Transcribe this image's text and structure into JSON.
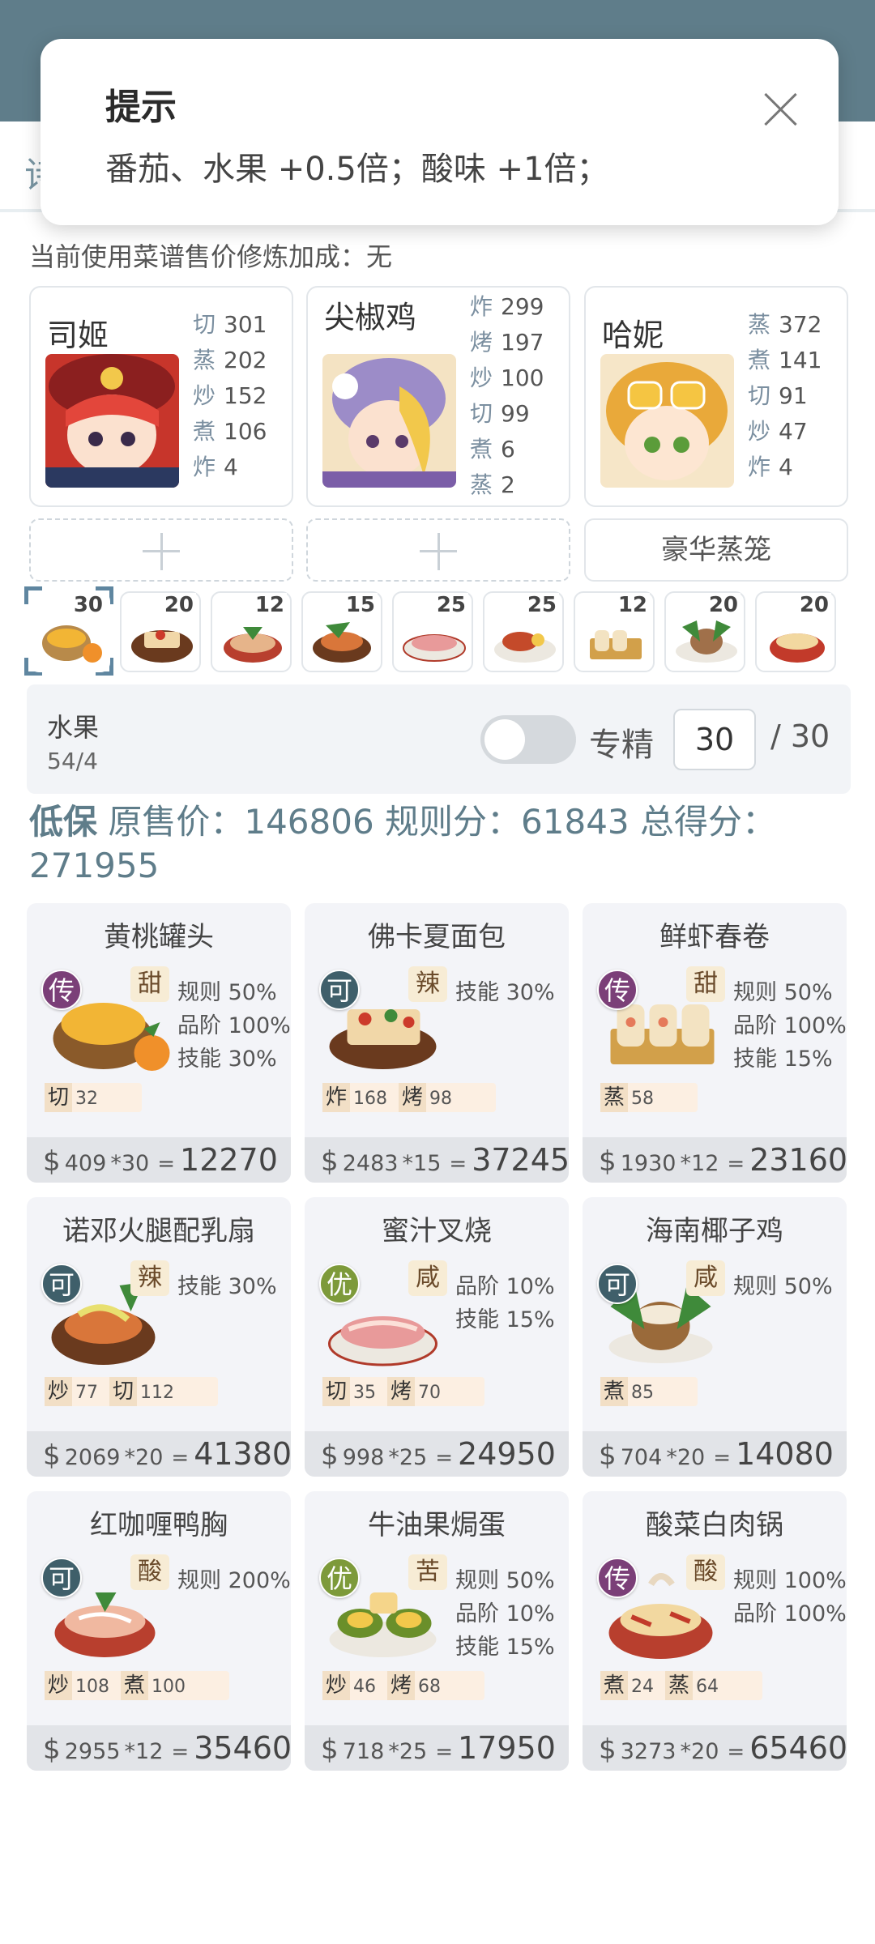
{
  "dialog": {
    "title": "提示",
    "message": "番茄、水果 +0.5倍；酸味 +1倍；",
    "tab_stub": "诗"
  },
  "bonus_line": "当前使用菜谱售价修炼加成：无",
  "chefs": [
    {
      "name": "司姬",
      "skills": [
        {
          "k": "切",
          "v": "301"
        },
        {
          "k": "蒸",
          "v": "202"
        },
        {
          "k": "炒",
          "v": "152"
        },
        {
          "k": "煮",
          "v": "106"
        },
        {
          "k": "炸",
          "v": "4"
        }
      ]
    },
    {
      "name": "尖椒鸡",
      "skills": [
        {
          "k": "炸",
          "v": "299"
        },
        {
          "k": "烤",
          "v": "197"
        },
        {
          "k": "炒",
          "v": "100"
        },
        {
          "k": "切",
          "v": "99"
        },
        {
          "k": "煮",
          "v": "6"
        },
        {
          "k": "蒸",
          "v": "2"
        }
      ]
    },
    {
      "name": "哈妮",
      "skills": [
        {
          "k": "蒸",
          "v": "372"
        },
        {
          "k": "煮",
          "v": "141"
        },
        {
          "k": "切",
          "v": "91"
        },
        {
          "k": "炒",
          "v": "47"
        },
        {
          "k": "炸",
          "v": "4"
        }
      ]
    }
  ],
  "equipment": {
    "label": "豪华蒸笼"
  },
  "dish_bar": [
    "30",
    "20",
    "12",
    "15",
    "25",
    "25",
    "12",
    "20",
    "20"
  ],
  "selected": {
    "name": "水果",
    "fraction": "54/4",
    "toggle_label": "专精",
    "qty": "30",
    "max": "/ 30"
  },
  "summary": {
    "lead": "低保",
    "text": " 原售价：146806 规则分：61843 总得分：271955"
  },
  "recipes": [
    {
      "name": "黄桃罐头",
      "rarity": "传",
      "rarity_color": "#7b3f78",
      "flavor": "甜",
      "buffs": [
        "规则 50%",
        "品阶 100%",
        "技能 30%"
      ],
      "req": [
        {
          "k": "切",
          "v": "32"
        }
      ],
      "unit": "409",
      "mult": "*30",
      "total": "12270"
    },
    {
      "name": "佛卡夏面包",
      "rarity": "可",
      "rarity_color": "#3f5f6a",
      "flavor": "辣",
      "buffs": [
        "技能 30%"
      ],
      "req": [
        {
          "k": "炸",
          "v": "168"
        },
        {
          "k": "烤",
          "v": "98"
        }
      ],
      "unit": "2483",
      "mult": "*15",
      "total": "37245"
    },
    {
      "name": "鲜虾春卷",
      "rarity": "传",
      "rarity_color": "#7b3f78",
      "flavor": "甜",
      "buffs": [
        "规则 50%",
        "品阶 100%",
        "技能 15%"
      ],
      "req": [
        {
          "k": "蒸",
          "v": "58"
        }
      ],
      "unit": "1930",
      "mult": "*12",
      "total": "23160"
    },
    {
      "name": "诺邓火腿配乳扇",
      "rarity": "可",
      "rarity_color": "#3f5f6a",
      "flavor": "辣",
      "buffs": [
        "技能 30%"
      ],
      "req": [
        {
          "k": "炒",
          "v": "77"
        },
        {
          "k": "切",
          "v": "112"
        }
      ],
      "unit": "2069",
      "mult": "*20",
      "total": "41380"
    },
    {
      "name": "蜜汁叉烧",
      "rarity": "优",
      "rarity_color": "#7d9a3a",
      "flavor": "咸",
      "buffs": [
        "品阶 10%",
        "技能 15%"
      ],
      "req": [
        {
          "k": "切",
          "v": "35"
        },
        {
          "k": "烤",
          "v": "70"
        }
      ],
      "unit": "998",
      "mult": "*25",
      "total": "24950"
    },
    {
      "name": "海南椰子鸡",
      "rarity": "可",
      "rarity_color": "#3f5f6a",
      "flavor": "咸",
      "buffs": [
        "规则 50%"
      ],
      "req": [
        {
          "k": "煮",
          "v": "85"
        }
      ],
      "unit": "704",
      "mult": "*20",
      "total": "14080"
    },
    {
      "name": "红咖喱鸭胸",
      "rarity": "可",
      "rarity_color": "#3f5f6a",
      "flavor": "酸",
      "buffs": [
        "规则 200%"
      ],
      "req": [
        {
          "k": "炒",
          "v": "108"
        },
        {
          "k": "煮",
          "v": "100"
        }
      ],
      "unit": "2955",
      "mult": "*12",
      "total": "35460"
    },
    {
      "name": "牛油果焗蛋",
      "rarity": "优",
      "rarity_color": "#7d9a3a",
      "flavor": "苦",
      "buffs": [
        "规则 50%",
        "品阶 10%",
        "技能 15%"
      ],
      "req": [
        {
          "k": "炒",
          "v": "46"
        },
        {
          "k": "烤",
          "v": "68"
        }
      ],
      "unit": "718",
      "mult": "*25",
      "total": "17950"
    },
    {
      "name": "酸菜白肉锅",
      "rarity": "传",
      "rarity_color": "#7b3f78",
      "flavor": "酸",
      "buffs": [
        "规则 100%",
        "品阶 100%"
      ],
      "req": [
        {
          "k": "煮",
          "v": "24"
        },
        {
          "k": "蒸",
          "v": "64"
        }
      ],
      "unit": "3273",
      "mult": "*20",
      "total": "65460"
    }
  ]
}
